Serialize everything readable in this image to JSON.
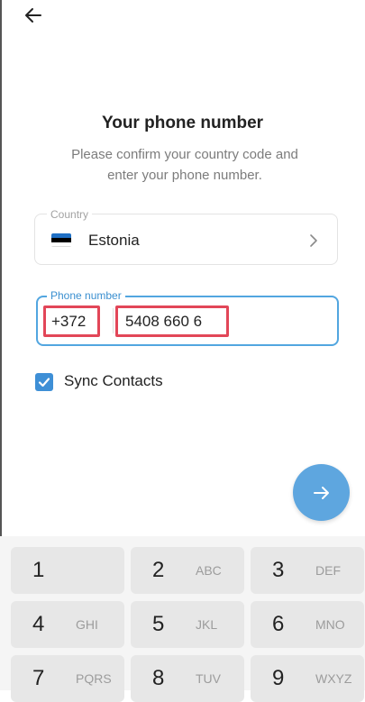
{
  "header": {
    "title": "Your phone number",
    "subtitle": "Please confirm your country code and enter your phone number."
  },
  "country": {
    "label": "Country",
    "value": "Estonia"
  },
  "phone": {
    "label": "Phone number",
    "code": "+372",
    "number": "5408 660 6"
  },
  "sync": {
    "label": "Sync Contacts",
    "checked": true
  },
  "keypad": {
    "keys": [
      {
        "digit": "1",
        "letters": ""
      },
      {
        "digit": "2",
        "letters": "ABC"
      },
      {
        "digit": "3",
        "letters": "DEF"
      },
      {
        "digit": "4",
        "letters": "GHI"
      },
      {
        "digit": "5",
        "letters": "JKL"
      },
      {
        "digit": "6",
        "letters": "MNO"
      },
      {
        "digit": "7",
        "letters": "PQRS"
      },
      {
        "digit": "8",
        "letters": "TUV"
      },
      {
        "digit": "9",
        "letters": "WXYZ"
      }
    ]
  },
  "colors": {
    "accent": "#52a6e0",
    "highlight": "#e24658",
    "checkbox": "#3e8fd6",
    "fab": "#5ea6df"
  },
  "icons": {
    "back": "arrow-left-icon",
    "chevron": "chevron-right-icon",
    "next": "arrow-right-icon",
    "check": "check-icon",
    "flag": "estonia-flag-icon"
  }
}
